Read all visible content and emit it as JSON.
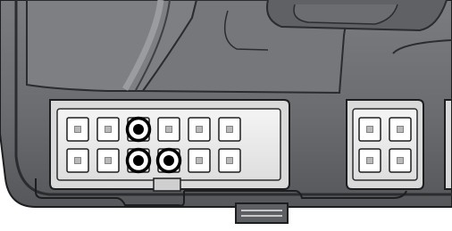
{
  "figure": {
    "subject": "connector-diagram",
    "colors": {
      "background": "#ffffff",
      "housing_fill": "#6b6d70",
      "housing_dark": "#3c3e41",
      "housing_light": "#8d8f92",
      "outline": "#1d1e20",
      "connector_face": "#ececec",
      "pin_slot": "#ffffff",
      "pin_center": "#b9b9b9",
      "marker_ring": "#000000",
      "marker_fill": "#ffffff",
      "marker_dot": "#000000"
    },
    "large_connector": {
      "rows": 2,
      "columns": 6,
      "highlighted_pins": [
        {
          "row": 1,
          "column": 3
        },
        {
          "row": 2,
          "column": 3
        },
        {
          "row": 2,
          "column": 4
        }
      ]
    },
    "small_connector": {
      "rows": 2,
      "columns": 2,
      "highlighted_pins": []
    },
    "icons": [
      "pin-marker-icon",
      "latch-clip-icon"
    ]
  }
}
